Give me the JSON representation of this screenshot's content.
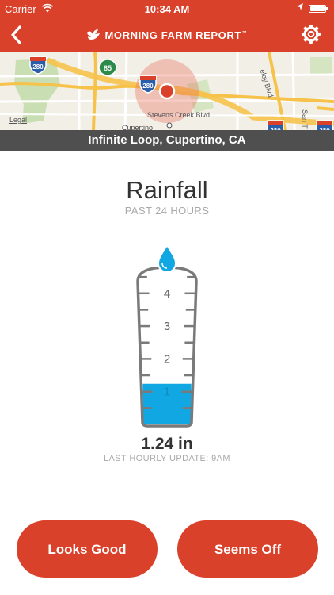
{
  "status_bar": {
    "carrier": "Carrier",
    "time": "10:34 AM"
  },
  "nav": {
    "title": "MORNING FARM REPORT",
    "trademark": "™",
    "icons": [
      "back-chevron-icon",
      "bird-logo-icon",
      "gear-icon"
    ]
  },
  "map": {
    "street_label": "Stevens Creek Blvd",
    "city_label": "Cupertino",
    "legal": "Legal",
    "vertical_label_1": "eley Blvd",
    "vertical_label_2": "San T",
    "shields": [
      {
        "label": "280",
        "type": "interstate"
      },
      {
        "label": "85",
        "type": "state"
      },
      {
        "label": "280",
        "type": "interstate"
      },
      {
        "label": "280",
        "type": "interstate"
      },
      {
        "label": "280",
        "type": "interstate"
      }
    ]
  },
  "location": "Infinite Loop, Cupertino, CA",
  "rainfall": {
    "title": "Rainfall",
    "subtitle": "PAST 24 HOURS",
    "gauge_ticks": [
      "4",
      "3",
      "2",
      "1"
    ],
    "gauge_max": 4.6,
    "amount": 1.24,
    "reading": "1.24 in",
    "last_update": "LAST HOURLY UPDATE: 9AM"
  },
  "actions": {
    "looks_good": "Looks Good",
    "seems_off": "Seems Off"
  },
  "colors": {
    "brand_red": "#d9412a",
    "water_blue": "#11a7e3",
    "banner_gray": "#4f4f4f"
  }
}
